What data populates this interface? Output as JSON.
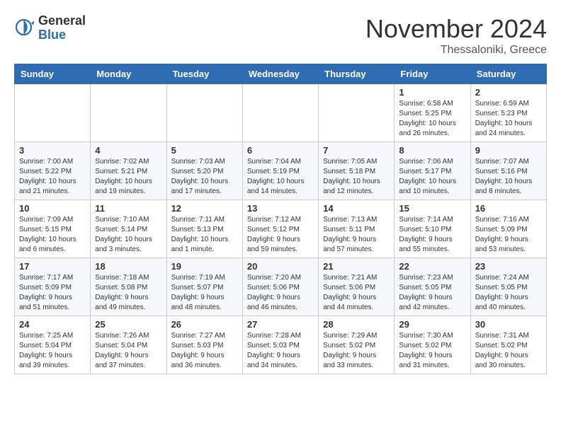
{
  "header": {
    "logo_general": "General",
    "logo_blue": "Blue",
    "month": "November 2024",
    "location": "Thessaloniki, Greece"
  },
  "weekdays": [
    "Sunday",
    "Monday",
    "Tuesday",
    "Wednesday",
    "Thursday",
    "Friday",
    "Saturday"
  ],
  "weeks": [
    [
      {
        "day": "",
        "info": ""
      },
      {
        "day": "",
        "info": ""
      },
      {
        "day": "",
        "info": ""
      },
      {
        "day": "",
        "info": ""
      },
      {
        "day": "",
        "info": ""
      },
      {
        "day": "1",
        "info": "Sunrise: 6:58 AM\nSunset: 5:25 PM\nDaylight: 10 hours\nand 26 minutes."
      },
      {
        "day": "2",
        "info": "Sunrise: 6:59 AM\nSunset: 5:23 PM\nDaylight: 10 hours\nand 24 minutes."
      }
    ],
    [
      {
        "day": "3",
        "info": "Sunrise: 7:00 AM\nSunset: 5:22 PM\nDaylight: 10 hours\nand 21 minutes."
      },
      {
        "day": "4",
        "info": "Sunrise: 7:02 AM\nSunset: 5:21 PM\nDaylight: 10 hours\nand 19 minutes."
      },
      {
        "day": "5",
        "info": "Sunrise: 7:03 AM\nSunset: 5:20 PM\nDaylight: 10 hours\nand 17 minutes."
      },
      {
        "day": "6",
        "info": "Sunrise: 7:04 AM\nSunset: 5:19 PM\nDaylight: 10 hours\nand 14 minutes."
      },
      {
        "day": "7",
        "info": "Sunrise: 7:05 AM\nSunset: 5:18 PM\nDaylight: 10 hours\nand 12 minutes."
      },
      {
        "day": "8",
        "info": "Sunrise: 7:06 AM\nSunset: 5:17 PM\nDaylight: 10 hours\nand 10 minutes."
      },
      {
        "day": "9",
        "info": "Sunrise: 7:07 AM\nSunset: 5:16 PM\nDaylight: 10 hours\nand 8 minutes."
      }
    ],
    [
      {
        "day": "10",
        "info": "Sunrise: 7:09 AM\nSunset: 5:15 PM\nDaylight: 10 hours\nand 6 minutes."
      },
      {
        "day": "11",
        "info": "Sunrise: 7:10 AM\nSunset: 5:14 PM\nDaylight: 10 hours\nand 3 minutes."
      },
      {
        "day": "12",
        "info": "Sunrise: 7:11 AM\nSunset: 5:13 PM\nDaylight: 10 hours\nand 1 minute."
      },
      {
        "day": "13",
        "info": "Sunrise: 7:12 AM\nSunset: 5:12 PM\nDaylight: 9 hours\nand 59 minutes."
      },
      {
        "day": "14",
        "info": "Sunrise: 7:13 AM\nSunset: 5:11 PM\nDaylight: 9 hours\nand 57 minutes."
      },
      {
        "day": "15",
        "info": "Sunrise: 7:14 AM\nSunset: 5:10 PM\nDaylight: 9 hours\nand 55 minutes."
      },
      {
        "day": "16",
        "info": "Sunrise: 7:16 AM\nSunset: 5:09 PM\nDaylight: 9 hours\nand 53 minutes."
      }
    ],
    [
      {
        "day": "17",
        "info": "Sunrise: 7:17 AM\nSunset: 5:09 PM\nDaylight: 9 hours\nand 51 minutes."
      },
      {
        "day": "18",
        "info": "Sunrise: 7:18 AM\nSunset: 5:08 PM\nDaylight: 9 hours\nand 49 minutes."
      },
      {
        "day": "19",
        "info": "Sunrise: 7:19 AM\nSunset: 5:07 PM\nDaylight: 9 hours\nand 48 minutes."
      },
      {
        "day": "20",
        "info": "Sunrise: 7:20 AM\nSunset: 5:06 PM\nDaylight: 9 hours\nand 46 minutes."
      },
      {
        "day": "21",
        "info": "Sunrise: 7:21 AM\nSunset: 5:06 PM\nDaylight: 9 hours\nand 44 minutes."
      },
      {
        "day": "22",
        "info": "Sunrise: 7:23 AM\nSunset: 5:05 PM\nDaylight: 9 hours\nand 42 minutes."
      },
      {
        "day": "23",
        "info": "Sunrise: 7:24 AM\nSunset: 5:05 PM\nDaylight: 9 hours\nand 40 minutes."
      }
    ],
    [
      {
        "day": "24",
        "info": "Sunrise: 7:25 AM\nSunset: 5:04 PM\nDaylight: 9 hours\nand 39 minutes."
      },
      {
        "day": "25",
        "info": "Sunrise: 7:26 AM\nSunset: 5:04 PM\nDaylight: 9 hours\nand 37 minutes."
      },
      {
        "day": "26",
        "info": "Sunrise: 7:27 AM\nSunset: 5:03 PM\nDaylight: 9 hours\nand 36 minutes."
      },
      {
        "day": "27",
        "info": "Sunrise: 7:28 AM\nSunset: 5:03 PM\nDaylight: 9 hours\nand 34 minutes."
      },
      {
        "day": "28",
        "info": "Sunrise: 7:29 AM\nSunset: 5:02 PM\nDaylight: 9 hours\nand 33 minutes."
      },
      {
        "day": "29",
        "info": "Sunrise: 7:30 AM\nSunset: 5:02 PM\nDaylight: 9 hours\nand 31 minutes."
      },
      {
        "day": "30",
        "info": "Sunrise: 7:31 AM\nSunset: 5:02 PM\nDaylight: 9 hours\nand 30 minutes."
      }
    ]
  ]
}
